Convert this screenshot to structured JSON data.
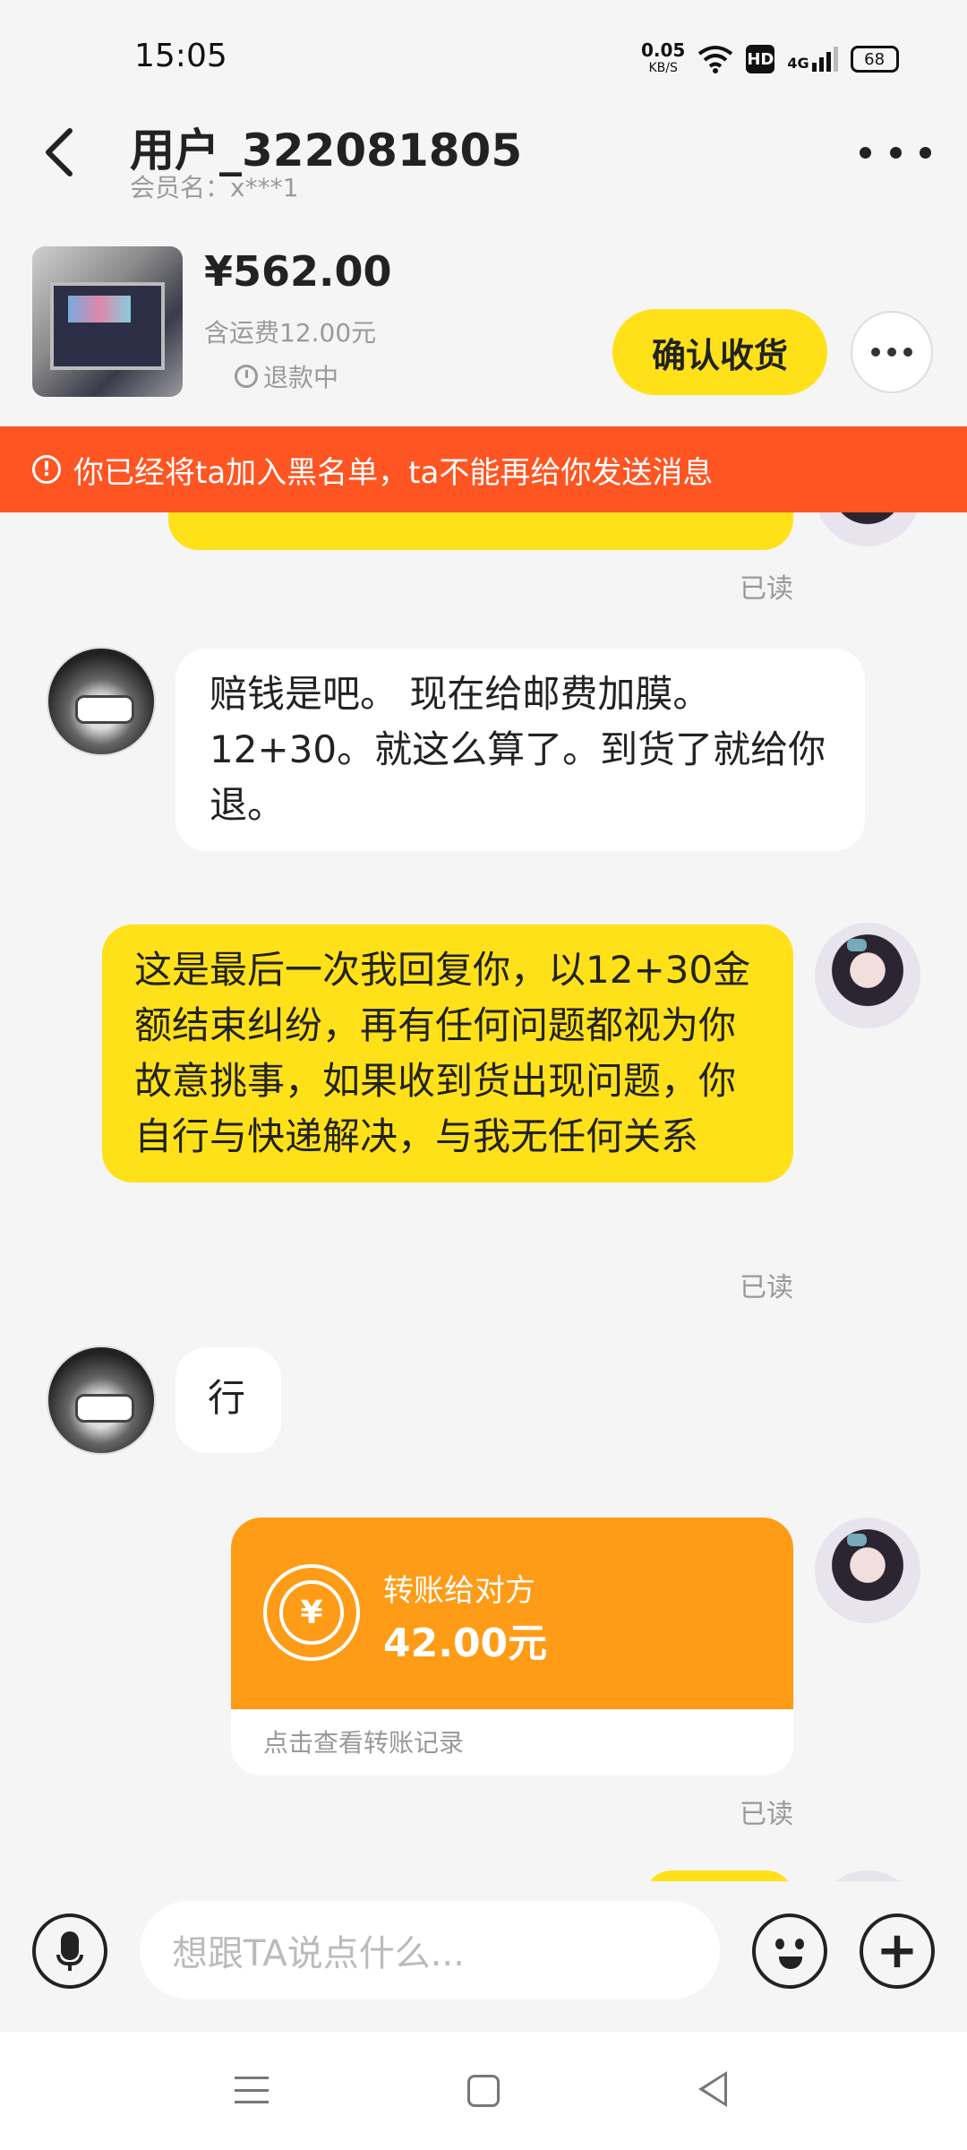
{
  "status_bar": {
    "time": "15:05",
    "net_speed": "0.05",
    "net_unit": "KB/S",
    "hd": "HD",
    "network": "4G",
    "battery": "68"
  },
  "header": {
    "title": "用户_322081805",
    "member_label": "会员名：x***1"
  },
  "product": {
    "price": "¥562.00",
    "shipping": "含运费12.00元",
    "status": "退款中",
    "confirm_label": "确认收货"
  },
  "banner": {
    "text": "你已经将ta加入黑名单，ta不能再给你发送消息"
  },
  "messages": [
    {
      "from": "me",
      "read": "已读"
    },
    {
      "from": "them",
      "text": "赔钱是吧。 现在给邮费加膜。12+30。就这么算了。到货了就给你退。"
    },
    {
      "from": "me",
      "text": "这是最后一次我回复你，以12+30金额结束纠纷，再有任何问题都视为你故意挑事，如果收到货出现问题，你自行与快递解决，与我无任何关系",
      "read": "已读"
    },
    {
      "from": "them",
      "text": "行"
    },
    {
      "from": "me",
      "type": "transfer",
      "title": "转账给对方",
      "amount": "42.00元",
      "footer": "点击查看转账记录",
      "yen": "¥",
      "read": "已读"
    }
  ],
  "input": {
    "placeholder": "想跟TA说点什么..."
  },
  "colors": {
    "accent_yellow": "#ffe11a",
    "banner_red": "#ff5522",
    "transfer_orange": "#ff9c17"
  }
}
